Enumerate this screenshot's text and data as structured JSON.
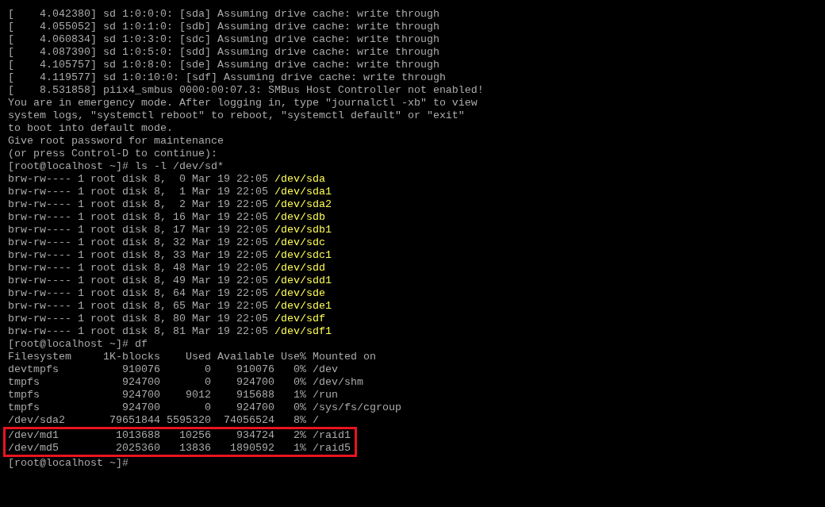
{
  "console": {
    "lines": [
      {
        "kind": "text",
        "text": "[    4.042380] sd 1:0:0:0: [sda] Assuming drive cache: write through"
      },
      {
        "kind": "text",
        "text": "[    4.055052] sd 1:0:1:0: [sdb] Assuming drive cache: write through"
      },
      {
        "kind": "text",
        "text": "[    4.060834] sd 1:0:3:0: [sdc] Assuming drive cache: write through"
      },
      {
        "kind": "text",
        "text": "[    4.087390] sd 1:0:5:0: [sdd] Assuming drive cache: write through"
      },
      {
        "kind": "text",
        "text": "[    4.105757] sd 1:0:8:0: [sde] Assuming drive cache: write through"
      },
      {
        "kind": "text",
        "text": "[    4.119577] sd 1:0:10:0: [sdf] Assuming drive cache: write through"
      },
      {
        "kind": "text",
        "text": "[    8.531858] piix4_smbus 0000:00:07.3: SMBus Host Controller not enabled!"
      },
      {
        "kind": "text",
        "text": "You are in emergency mode. After logging in, type \"journalctl -xb\" to view"
      },
      {
        "kind": "text",
        "text": "system logs, \"systemctl reboot\" to reboot, \"systemctl default\" or \"exit\""
      },
      {
        "kind": "text",
        "text": "to boot into default mode."
      },
      {
        "kind": "text",
        "text": "Give root password for maintenance"
      },
      {
        "kind": "text",
        "text": "(or press Control-D to continue):"
      },
      {
        "kind": "prompt",
        "text": "[root@localhost ~]# ls -l /dev/sd*"
      },
      {
        "kind": "listing",
        "text": "brw-rw---- 1 root disk 8,  0 Mar 19 22:05",
        "device": "/dev/sda"
      },
      {
        "kind": "listing",
        "text": "brw-rw---- 1 root disk 8,  1 Mar 19 22:05",
        "device": "/dev/sda1"
      },
      {
        "kind": "listing",
        "text": "brw-rw---- 1 root disk 8,  2 Mar 19 22:05",
        "device": "/dev/sda2"
      },
      {
        "kind": "listing",
        "text": "brw-rw---- 1 root disk 8, 16 Mar 19 22:05",
        "device": "/dev/sdb"
      },
      {
        "kind": "listing",
        "text": "brw-rw---- 1 root disk 8, 17 Mar 19 22:05",
        "device": "/dev/sdb1"
      },
      {
        "kind": "listing",
        "text": "brw-rw---- 1 root disk 8, 32 Mar 19 22:05",
        "device": "/dev/sdc"
      },
      {
        "kind": "listing",
        "text": "brw-rw---- 1 root disk 8, 33 Mar 19 22:05",
        "device": "/dev/sdc1"
      },
      {
        "kind": "listing",
        "text": "brw-rw---- 1 root disk 8, 48 Mar 19 22:05",
        "device": "/dev/sdd"
      },
      {
        "kind": "listing",
        "text": "brw-rw---- 1 root disk 8, 49 Mar 19 22:05",
        "device": "/dev/sdd1"
      },
      {
        "kind": "listing",
        "text": "brw-rw---- 1 root disk 8, 64 Mar 19 22:05",
        "device": "/dev/sde"
      },
      {
        "kind": "listing",
        "text": "brw-rw---- 1 root disk 8, 65 Mar 19 22:05",
        "device": "/dev/sde1"
      },
      {
        "kind": "listing",
        "text": "brw-rw---- 1 root disk 8, 80 Mar 19 22:05",
        "device": "/dev/sdf"
      },
      {
        "kind": "listing",
        "text": "brw-rw---- 1 root disk 8, 81 Mar 19 22:05",
        "device": "/dev/sdf1"
      },
      {
        "kind": "prompt",
        "text": "[root@localhost ~]# df"
      },
      {
        "kind": "text",
        "text": "Filesystem     1K-blocks    Used Available Use% Mounted on"
      },
      {
        "kind": "text",
        "text": "devtmpfs          910076       0    910076   0% /dev"
      },
      {
        "kind": "text",
        "text": "tmpfs             924700       0    924700   0% /dev/shm"
      },
      {
        "kind": "text",
        "text": "tmpfs             924700    9012    915688   1% /run"
      },
      {
        "kind": "text",
        "text": "tmpfs             924700       0    924700   0% /sys/fs/cgroup"
      },
      {
        "kind": "text",
        "text": "/dev/sda2       79651844 5595320  74056524   8% /"
      },
      {
        "kind": "box",
        "lines": [
          {
            "text": "/dev/md1         1013688   10256    934724   2% /raid1"
          },
          {
            "text": "/dev/md5         2025360   13836   1890592   1% /raid5"
          }
        ]
      },
      {
        "kind": "prompt",
        "text": "[root@localhost ~]#"
      }
    ]
  }
}
